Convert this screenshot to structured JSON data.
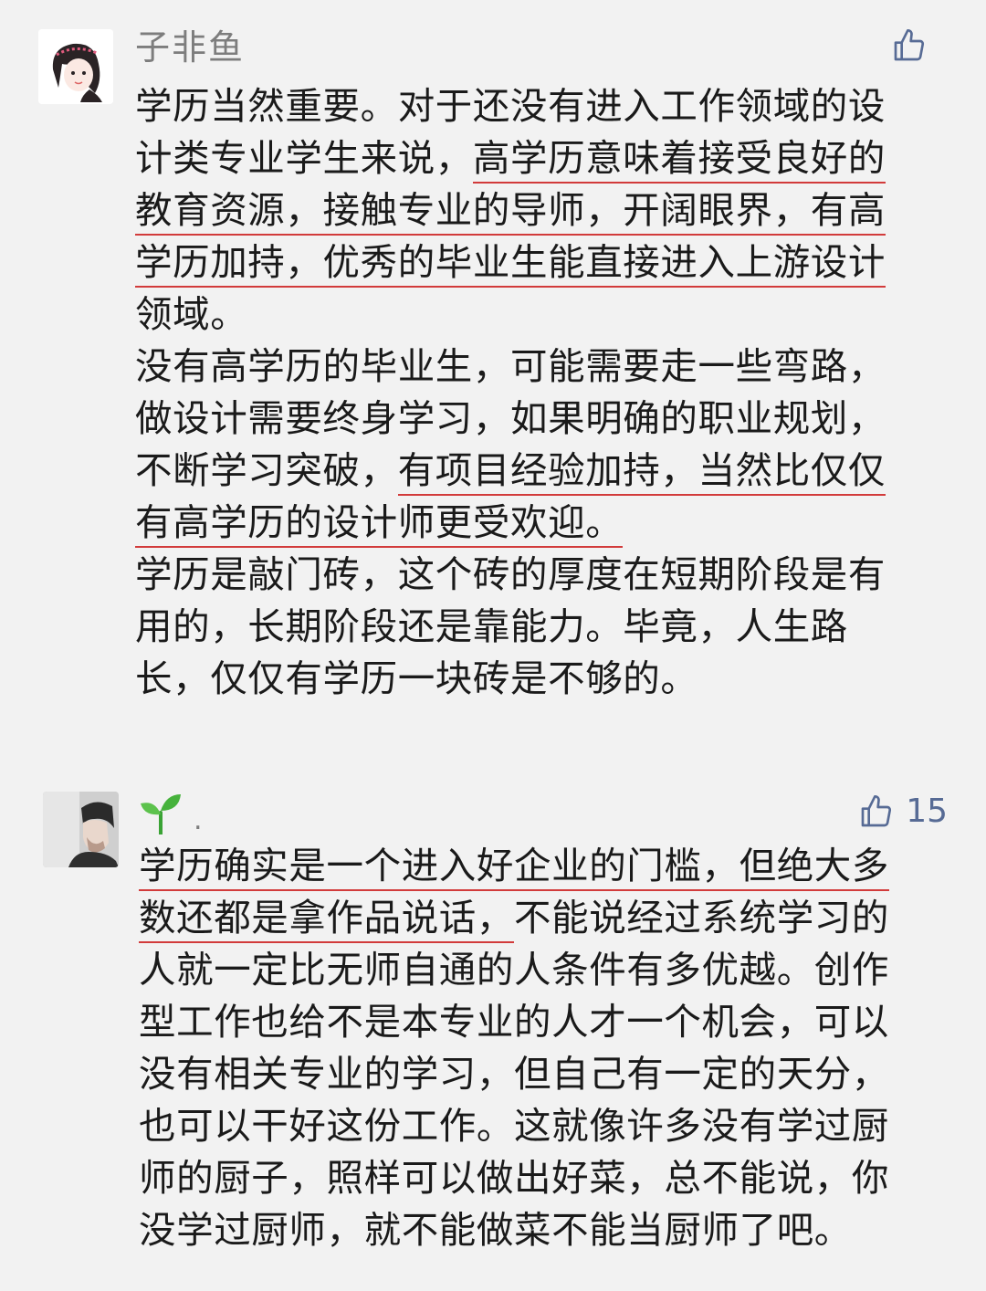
{
  "comments": [
    {
      "username": "子非鱼",
      "likes": "",
      "lines": [
        [
          {
            "t": "学历当然重要。对于还没有进入工作领域的设"
          }
        ],
        [
          {
            "t": "计类专业学生来说，"
          },
          {
            "t": "高学历意味着接受良好的",
            "u": true
          }
        ],
        [
          {
            "t": "教育资源，接触专业的导师，开阔眼界，有高",
            "u": true
          }
        ],
        [
          {
            "t": "学历加持，优秀的毕业生能直接进入上游设计",
            "u": true
          }
        ],
        [
          {
            "t": "领域。"
          }
        ],
        [
          {
            "t": "没有高学历的毕业生，可能需要走一些弯路，"
          }
        ],
        [
          {
            "t": "做设计需要终身学习，如果明确的职业规划，"
          }
        ],
        [
          {
            "t": "不断学习突破，"
          },
          {
            "t": "有项目经验加持，当然比仅仅",
            "u": true
          }
        ],
        [
          {
            "t": "有高学历的设计师更受欢迎。",
            "u": true
          }
        ],
        [
          {
            "t": "学历是敲门砖，这个砖的厚度在短期阶段是有"
          }
        ],
        [
          {
            "t": "用的，长期阶段还是靠能力。毕竟，人生路"
          }
        ],
        [
          {
            "t": "长，仅仅有学历一块砖是不够的。"
          }
        ]
      ]
    },
    {
      "username": ".",
      "likes": "15",
      "lines": [
        [
          {
            "t": "学历确实是一个进入好企业的门槛，但绝大多",
            "u": true
          }
        ],
        [
          {
            "t": "数还都是拿作品说话，",
            "u": true
          },
          {
            "t": "不能说经过系统学习的"
          }
        ],
        [
          {
            "t": "人就一定比无师自通的人条件有多优越。创作"
          }
        ],
        [
          {
            "t": "型工作也给不是本专业的人才一个机会，可以"
          }
        ],
        [
          {
            "t": "没有相关专业的学习，但自己有一定的天分，"
          }
        ],
        [
          {
            "t": "也可以干好这份工作。这就像许多没有学过厨"
          }
        ],
        [
          {
            "t": "师的厨子，照样可以做出好菜，总不能说，你"
          }
        ],
        [
          {
            "t": "没学过厨师，就不能做菜不能当厨师了吧。"
          }
        ]
      ]
    }
  ],
  "icons": {
    "like": "thumbs-up-icon",
    "sprout": "sprout-icon"
  },
  "colors": {
    "card_bg": "#f2f2f2",
    "text": "#1a1a1a",
    "username": "#7d7d7d",
    "like": "#576b95",
    "underline": "#d23b3b"
  }
}
